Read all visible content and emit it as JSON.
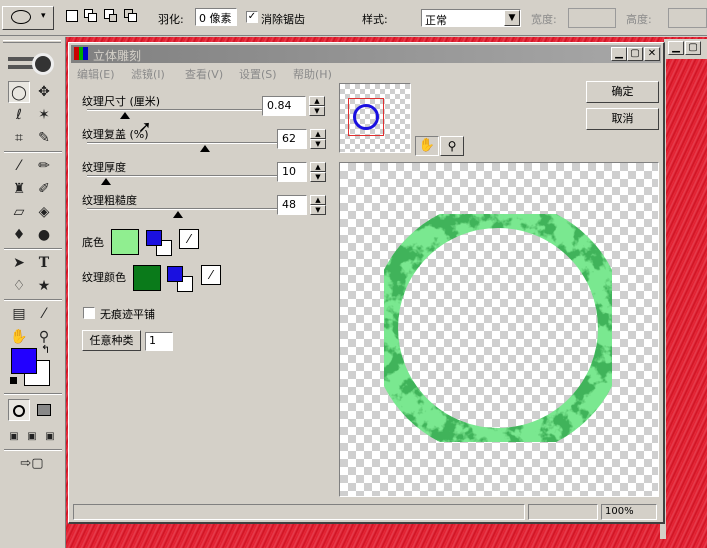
{
  "options_bar": {
    "feather_label": "羽化:",
    "feather_value": "0 像素",
    "antialias_label": "消除锯齿",
    "antialias_checked": true,
    "style_label": "样式:",
    "style_value": "正常",
    "width_label": "宽度:",
    "height_label": "高度:"
  },
  "dialog": {
    "title": "立体雕刻",
    "menu": [
      "编辑(E)",
      "滤镜(I)",
      "查看(V)",
      "设置(S)",
      "帮助(H)"
    ],
    "params": [
      {
        "label": "纹理尺寸 (厘米)",
        "value": "0.84",
        "level": 0.2
      },
      {
        "label": "纹理复盖 (%)",
        "value": "62",
        "level": 0.62
      },
      {
        "label": "纹理厚度",
        "value": "10",
        "level": 0.1
      },
      {
        "label": "纹理粗糙度",
        "value": "48",
        "level": 0.48
      }
    ],
    "base_color_label": "底色",
    "base_color": "#90ee90",
    "texture_color_label": "纹理颜色",
    "texture_color": "#0a7a1a",
    "seamless_label": "无痕迹平铺",
    "seamless_checked": false,
    "random_button": "任意种类",
    "random_value": "1",
    "ok_button": "确定",
    "cancel_button": "取消",
    "zoom": "100%"
  },
  "colors": {
    "foreground": "#2200ff",
    "background": "#ffffff",
    "mini_fg": "#1a10e0",
    "ring": "#7ae890",
    "canvas_red": "#e01828"
  },
  "icons": [
    "marquee-ellipse-icon",
    "move-icon",
    "lasso-icon",
    "magic-wand-icon",
    "crop-icon",
    "slice-icon",
    "brush-icon",
    "pencil-icon",
    "stamp-icon",
    "history-brush-icon",
    "eraser-icon",
    "bucket-icon",
    "blur-icon",
    "dodge-icon",
    "path-select-icon",
    "type-icon",
    "pen-icon",
    "shape-icon",
    "notes-icon",
    "eyedropper-icon",
    "hand-icon",
    "zoom-icon"
  ]
}
